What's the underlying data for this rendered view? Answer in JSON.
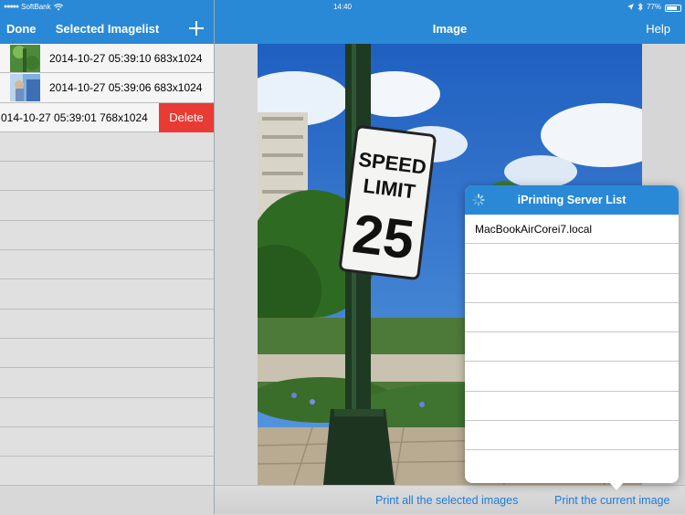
{
  "status": {
    "carrier": "SoftBank",
    "time": "14:40",
    "battery": "77%",
    "battery_level": 0.77
  },
  "left_nav": {
    "done_label": "Done",
    "title": "Selected Imagelist"
  },
  "right_nav": {
    "title": "Image",
    "help_label": "Help"
  },
  "image_list": [
    {
      "text": "2014-10-27 05:39:10 683x1024"
    },
    {
      "text": "2014-10-27 05:39:06 683x1024"
    },
    {
      "text": "014-10-27 05:39:01 768x1024",
      "delete_label": "Delete"
    }
  ],
  "photo": {
    "sign_line1": "SPEED",
    "sign_line2": "LIMIT",
    "sign_number": "25"
  },
  "popover": {
    "title": "iPrinting Server List",
    "servers": [
      "MacBookAirCorei7.local"
    ]
  },
  "toolbar": {
    "print_all_label": "Print all the selected images",
    "print_current_label": "Print the current image"
  },
  "colors": {
    "accent": "#2a89d6",
    "delete": "#e93a33",
    "link": "#1a7de0"
  }
}
